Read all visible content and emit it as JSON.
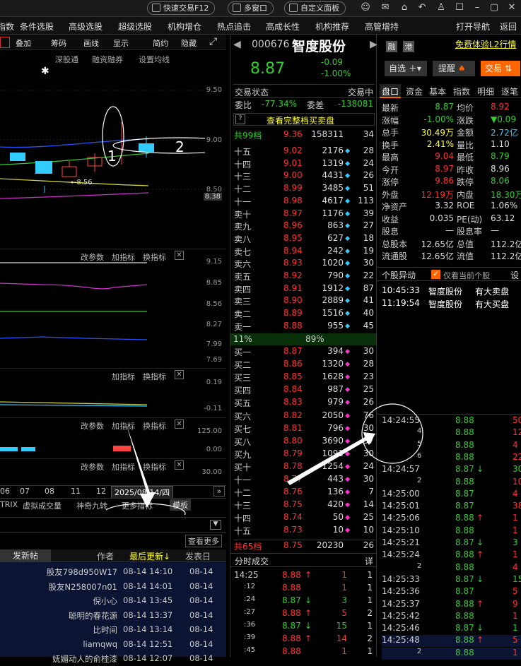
{
  "topbar": {
    "quick_trade": "快速交易F12",
    "multi_window": "多窗口",
    "custom_panel": "自定义面板"
  },
  "menu": {
    "items": [
      "指数",
      "条件选股",
      "高级选股",
      "超级选股",
      "机构增仓",
      "热点追击",
      "高成长性",
      "机构推荐",
      "高管增持",
      "打开导航",
      "返回"
    ]
  },
  "chart": {
    "toolbar": [
      "叠加",
      "筹码",
      "画线",
      "显示",
      "简约",
      "隐藏"
    ],
    "tabs": [
      "深股通",
      "融资融券",
      "设置均线"
    ],
    "price_ticks": [
      "9.50",
      "9.00",
      "8.50",
      "8.38"
    ],
    "low_marker": "8.56",
    "annotation_1": "1",
    "annotation_2": "2",
    "ind_ticks_1": [
      "9.15",
      "8.85",
      "8.56",
      "8.27",
      "7.99",
      "7.69"
    ],
    "ind_ticks_2": [
      "0.19",
      "-0.11"
    ],
    "ind_ticks_3": [
      "125.00",
      "0.00"
    ],
    "ind_ticks_4": [
      "30.00"
    ],
    "panel_btns": [
      "改参数",
      "加指标",
      "换指标"
    ],
    "x_labels": [
      "06",
      "07",
      "08",
      "11",
      "12"
    ],
    "date_box": "2025/08/14/四",
    "bottom_tabs": [
      "TRIX",
      "虚拟成交量",
      "神奇九转",
      "更多指标",
      "模板"
    ],
    "view_more": "查看更多"
  },
  "forum": {
    "post_btn": "发新帖",
    "col_author": "作者",
    "col_last": "最后更新",
    "col_posted": "发表日",
    "rows": [
      {
        "author": "股友798d950W17",
        "last": "08-14 14:10",
        "posted": "08-14"
      },
      {
        "author": "股友N258007n01",
        "last": "08-14 14:01",
        "posted": "08-14"
      },
      {
        "author": "倪小心",
        "last": "08-14 13:45",
        "posted": "08-14"
      },
      {
        "author": "聪明的春花源",
        "last": "08-14 13:37",
        "posted": "08-14"
      },
      {
        "author": "比时间",
        "last": "08-14 13:14",
        "posted": "08-14"
      },
      {
        "author": "liamqwq",
        "last": "08-14 12:51",
        "posted": "08-14"
      },
      {
        "author": "妩媚动人的俞桂漆",
        "last": "08-14 12:07",
        "posted": "08-14"
      }
    ]
  },
  "stock": {
    "code": "000676",
    "name": "智度股份",
    "badge1": "融",
    "badge2": "港",
    "l2_promo": "免费体验L2行情",
    "price": "8.87",
    "change": "-0.09",
    "change_pct": "-1.00%",
    "add_watch": "自选",
    "remind": "提醒",
    "trade": "交易"
  },
  "orderbook": {
    "status_label": "交易状态",
    "status_value": "交易中",
    "ratio_label": "委比",
    "ratio_value": "-77.34%",
    "diff_label": "委差",
    "diff_value": "-138081",
    "view_full": "查看完整档买卖盘",
    "sell_total": {
      "label": "共99档",
      "price": "9.36",
      "vol": "158311",
      "cnt": "34"
    },
    "asks": [
      {
        "lb": "十五",
        "pr": "9.02",
        "vl": "2176",
        "ct": "28"
      },
      {
        "lb": "十四",
        "pr": "9.01",
        "vl": "1319",
        "ct": "24"
      },
      {
        "lb": "十三",
        "pr": "9.00",
        "vl": "4431",
        "ct": "26"
      },
      {
        "lb": "十二",
        "pr": "8.99",
        "vl": "3485",
        "ct": "51"
      },
      {
        "lb": "十一",
        "pr": "8.98",
        "vl": "4617",
        "ct": "113"
      },
      {
        "lb": "卖十",
        "pr": "8.97",
        "vl": "1176",
        "ct": "39"
      },
      {
        "lb": "卖九",
        "pr": "8.96",
        "vl": "863",
        "ct": "27"
      },
      {
        "lb": "卖八",
        "pr": "8.95",
        "vl": "627",
        "ct": "18"
      },
      {
        "lb": "卖七",
        "pr": "8.94",
        "vl": "242",
        "ct": "19"
      },
      {
        "lb": "卖六",
        "pr": "8.93",
        "vl": "1020",
        "ct": "30"
      },
      {
        "lb": "卖五",
        "pr": "8.92",
        "vl": "790",
        "ct": "22"
      },
      {
        "lb": "卖四",
        "pr": "8.91",
        "vl": "1912",
        "ct": "87"
      },
      {
        "lb": "卖三",
        "pr": "8.90",
        "vl": "2889",
        "ct": "41"
      },
      {
        "lb": "卖二",
        "pr": "8.89",
        "vl": "1516",
        "ct": "40"
      },
      {
        "lb": "卖一",
        "pr": "8.88",
        "vl": "955",
        "ct": "45"
      }
    ],
    "split_left": "11%",
    "split_right": "89%",
    "bids": [
      {
        "lb": "买一",
        "pr": "8.87",
        "vl": "394",
        "ct": "30"
      },
      {
        "lb": "买二",
        "pr": "8.86",
        "vl": "1320",
        "ct": "28"
      },
      {
        "lb": "买三",
        "pr": "8.85",
        "vl": "1628",
        "ct": "23"
      },
      {
        "lb": "买四",
        "pr": "8.84",
        "vl": "987",
        "ct": "25"
      },
      {
        "lb": "买五",
        "pr": "8.83",
        "vl": "979",
        "ct": "26"
      },
      {
        "lb": "买六",
        "pr": "8.82",
        "vl": "2050",
        "ct": "76"
      },
      {
        "lb": "买七",
        "pr": "8.81",
        "vl": "796",
        "ct": "30"
      },
      {
        "lb": "买八",
        "pr": "8.80",
        "vl": "3690",
        "ct": "37"
      },
      {
        "lb": "买九",
        "pr": "8.79",
        "vl": "1091",
        "ct": "30"
      },
      {
        "lb": "买十",
        "pr": "8.78",
        "vl": "1254",
        "ct": "24"
      },
      {
        "lb": "十一",
        "pr": "8.77",
        "vl": "443",
        "ct": "30"
      },
      {
        "lb": "十二",
        "pr": "8.76",
        "vl": "136",
        "ct": "7"
      },
      {
        "lb": "十三",
        "pr": "8.75",
        "vl": "420",
        "ct": "14"
      },
      {
        "lb": "十四",
        "pr": "8.74",
        "vl": "50",
        "ct": "25"
      },
      {
        "lb": "十五",
        "pr": "8.73",
        "vl": "10",
        "ct": "10"
      }
    ],
    "buy_total": {
      "label": "共65档",
      "price": "8.75",
      "vol": "20230",
      "cnt": "26"
    },
    "ticks_label": "分时成交",
    "ticks_detail": "详",
    "ticks": [
      {
        "t": "14:25",
        "p": "8.88",
        "d": "up",
        "v": "1",
        "n": "1"
      },
      {
        "t": ":12",
        "p": "8.88",
        "d": "",
        "v": "1",
        "n": "1"
      },
      {
        "t": ":24",
        "p": "8.87",
        "d": "down",
        "v": "3",
        "n": "1"
      },
      {
        "t": ":27",
        "p": "8.88",
        "d": "up",
        "v": "5",
        "n": "2"
      },
      {
        "t": ":36",
        "p": "8.87",
        "d": "down",
        "v": "15",
        "n": "1"
      },
      {
        "t": ":39",
        "p": "8.88",
        "d": "up",
        "v": "14",
        "n": "2"
      },
      {
        "t": ":45",
        "p": "8.88",
        "d": "",
        "v": "1",
        "n": "1"
      }
    ]
  },
  "quote": {
    "tabs": [
      "盘口",
      "资金",
      "基本",
      "指数",
      "明细",
      "逐笔"
    ],
    "rows": [
      [
        "最新",
        "8.87",
        "均价",
        "8.92"
      ],
      [
        "涨幅",
        "-1.00%",
        "涨跌",
        "▼0.09"
      ],
      [
        "总手",
        "30.49万",
        "金额",
        "2.72亿"
      ],
      [
        "换手",
        "2.41%",
        "量比",
        "1.10"
      ],
      [
        "最高",
        "9.04",
        "最低",
        "8.79"
      ],
      [
        "今开",
        "8.97",
        "昨收",
        "8.96"
      ],
      [
        "涨停",
        "9.86",
        "跌停",
        "8.06"
      ],
      [
        "外盘",
        "12.19万",
        "内盘",
        "18.30万"
      ],
      [
        "净资产",
        "3.32",
        "ROE",
        "1.06%"
      ],
      [
        "收益",
        "0.035",
        "PE(动)",
        "63.12"
      ],
      [
        "股息",
        "—",
        "股息率",
        "—"
      ],
      [
        "总股本",
        "12.65亿",
        "总值",
        "112.2亿"
      ],
      [
        "流通股",
        "12.65亿",
        "流值",
        "112.2亿"
      ]
    ],
    "alert_title": "个股异动",
    "alert_only": "仅看当前个股",
    "alert_set": "设",
    "alerts": [
      {
        "t": "10:45:33",
        "name": "智度股份",
        "ev": "有大卖盘"
      },
      {
        "t": "11:19:54",
        "name": "智度股份",
        "ev": "有大买盘"
      }
    ],
    "detail": [
      {
        "t": "14:24:55",
        "p": "8.88",
        "d": "",
        "v": "50"
      },
      {
        "t": "4",
        "p": "8.88",
        "d": "",
        "v": "12"
      },
      {
        "t": "5",
        "p": "8.88",
        "d": "",
        "v": "4"
      },
      {
        "t": "6",
        "p": "8.88",
        "d": "",
        "v": "22"
      },
      {
        "t": "14:24:57",
        "p": "8.87",
        "d": "down",
        "v": "30"
      },
      {
        "t": "2",
        "p": "8.88",
        "d": "",
        "v": "10"
      },
      {
        "t": "14:25:00",
        "p": "8.87",
        "d": "",
        "v": "4"
      },
      {
        "t": "14:25:01",
        "p": "8.87",
        "d": "",
        "v": "38"
      },
      {
        "t": "14:25:06",
        "p": "8.88",
        "d": "up",
        "v": "1"
      },
      {
        "t": "14:25:10",
        "p": "8.88",
        "d": "",
        "v": "1"
      },
      {
        "t": "14:25:21",
        "p": "8.87",
        "d": "down",
        "v": "3"
      },
      {
        "t": "14:25:24",
        "p": "8.88",
        "d": "up",
        "v": "1"
      },
      {
        "t": "2",
        "p": "8.88",
        "d": "",
        "v": "4"
      },
      {
        "t": "14:25:33",
        "p": "8.87",
        "d": "down",
        "v": "15"
      },
      {
        "t": "14:25:36",
        "p": "8.87",
        "d": "",
        "v": "5"
      },
      {
        "t": "14:25:37",
        "p": "8.88",
        "d": "up",
        "v": "9"
      },
      {
        "t": "14:25:42",
        "p": "8.88",
        "d": "",
        "v": "1"
      },
      {
        "t": "14:25:46",
        "p": "8.87",
        "d": "down",
        "v": "1"
      },
      {
        "t": "14:25:48",
        "p": "8.88",
        "d": "up",
        "v": "5"
      },
      {
        "t": "2",
        "p": "8.88",
        "d": "",
        "v": "1"
      }
    ]
  },
  "colors": {
    "up": "#ff3333",
    "down": "#33cc33",
    "accent": "#ff6600",
    "bg": "#000000"
  }
}
